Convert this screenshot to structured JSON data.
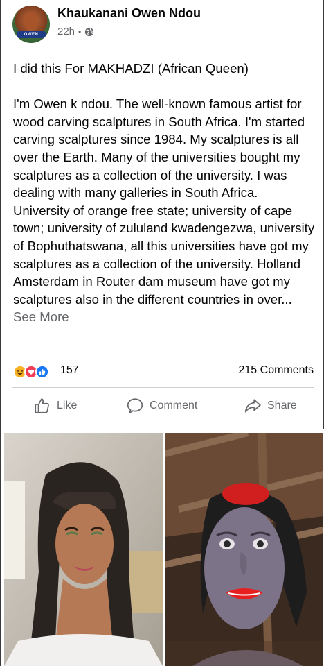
{
  "post": {
    "author": "Khaukanani Owen Ndou",
    "time": "22h",
    "separator": "•",
    "avatar_badge_text": "OWEN",
    "paragraph_1": "I did this For MAKHADZI (African Queen)",
    "paragraph_2": "I'm Owen k ndou. The well-known famous artist for wood carving scalptures in South Africa. I'm started carving scalptures since 1984. My scalptures is all over the Earth. Many of the universities bought my scalptures as a collection of the university. I was dealing with many galleries in South Africa. University of orange free state; university of cape town; university of zululand kwadengezwa, university of Bophuthatswana, all this universities have got my scalptures as a collection of the university. Holland Amsterdam in Router dam museum have got my scalptures also in the different countries in over...",
    "see_more": "See More"
  },
  "stats": {
    "reaction_icons": [
      "haha-icon",
      "love-icon",
      "like-icon"
    ],
    "reaction_count": "157",
    "comments": "215 Comments"
  },
  "actions": {
    "like_label": "Like",
    "comment_label": "Comment",
    "share_label": "Share"
  },
  "colors": {
    "text": "#050505",
    "secondary_text": "#65676b",
    "like_blue": "#1877f2",
    "love_red": "#f33e58",
    "haha_yellow": "#f7b125",
    "divider": "#ced0d4"
  },
  "icons": {
    "privacy": "globe-icon",
    "like": "thumbs-up-outline-icon",
    "comment": "speech-bubble-icon",
    "share": "share-arrow-icon"
  }
}
